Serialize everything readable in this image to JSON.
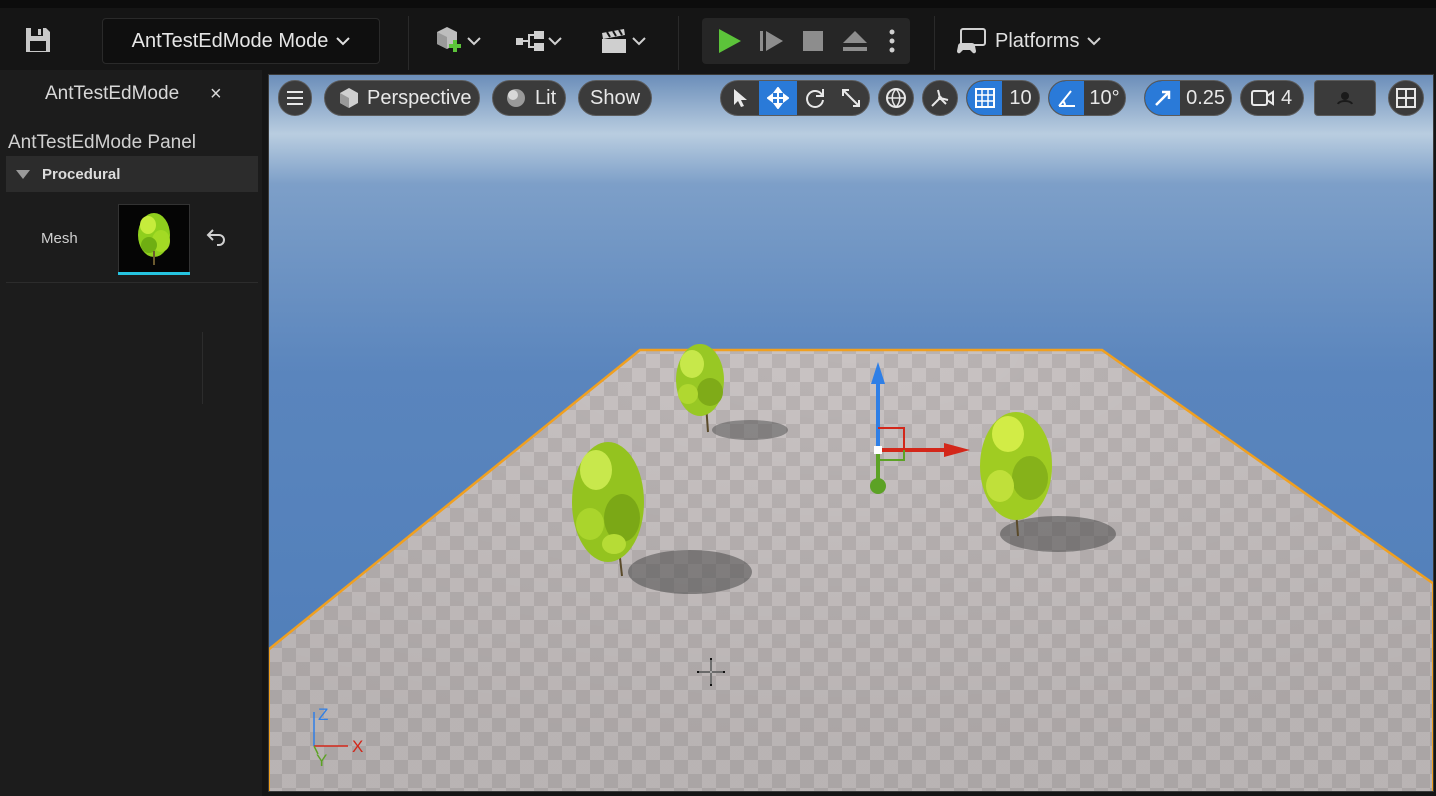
{
  "toolbar": {
    "mode_label": "AntTestEdMode Mode",
    "platforms_label": "Platforms"
  },
  "panel": {
    "tab_label": "AntTestEdMode",
    "tab_close": "×",
    "title": "AntTestEdMode Panel",
    "category": "Procedural",
    "mesh_label": "Mesh"
  },
  "viewport": {
    "view_mode": "Perspective",
    "lighting": "Lit",
    "show": "Show",
    "grid_snap": "10",
    "rotation_snap": "10°",
    "scale_snap": "0.25",
    "camera_speed": "4",
    "gizmo_axes": {
      "z": "Z",
      "x": "X",
      "y": "Y"
    }
  },
  "colors": {
    "accent": "#2a7ad8",
    "play_green": "#5cc33a",
    "selection_orange": "#f0a020",
    "axis_x": "#d3271a",
    "axis_y": "#5ca225",
    "axis_z": "#2f7fe6"
  }
}
